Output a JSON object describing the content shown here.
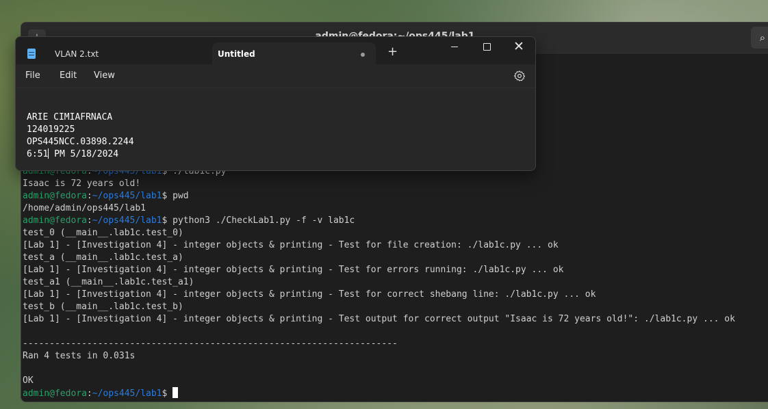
{
  "terminal": {
    "title": "admin@fedora:~/ops445/lab1",
    "new_tab_icon": "+",
    "search_icon": "⌕",
    "prompt_host": "admin@fedora",
    "prompt_sep": ":",
    "prompt_path": "~/ops445/lab1",
    "prompt_dollar": "$",
    "lines": [
      {
        "cmd": " ./lab1c.py"
      },
      {
        "text": "Isaac is 72 years old!"
      },
      {
        "cmd": " pwd"
      },
      {
        "text": "/home/admin/ops445/lab1"
      },
      {
        "cmd": " python3 ./CheckLab1.py -f -v lab1c"
      },
      {
        "text": "test_0 (__main__.lab1c.test_0)"
      },
      {
        "text": "[Lab 1] - [Investigation 4] - integer objects & printing - Test for file creation: ./lab1c.py ... ok"
      },
      {
        "text": "test_a (__main__.lab1c.test_a)"
      },
      {
        "text": "[Lab 1] - [Investigation 4] - integer objects & printing - Test for errors running: ./lab1c.py ... ok"
      },
      {
        "text": "test_a1 (__main__.lab1c.test_a1)"
      },
      {
        "text": "[Lab 1] - [Investigation 4] - integer objects & printing - Test for correct shebang line: ./lab1c.py ... ok"
      },
      {
        "text": "test_b (__main__.lab1c.test_b)"
      },
      {
        "text": "[Lab 1] - [Investigation 4] - integer objects & printing - Test output for correct output \"Isaac is 72 years old!\": ./lab1c.py ... ok"
      },
      {
        "text": ""
      },
      {
        "text": "----------------------------------------------------------------------"
      },
      {
        "text": "Ran 4 tests in 0.031s"
      },
      {
        "text": ""
      },
      {
        "text": "OK"
      }
    ]
  },
  "notepad": {
    "tabs": [
      {
        "label": "VLAN 2.txt"
      },
      {
        "label": "Untitled",
        "unsaved": true
      }
    ],
    "new_tab_label": "+",
    "menu": {
      "file": "File",
      "edit": "Edit",
      "view": "View"
    },
    "lines": [
      "ARIE CIMIAFRNACA",
      "124019225",
      "OPS445NCC.03898.2244"
    ],
    "last_line_before_caret": "6:51",
    "last_line_after_caret": " PM 5/18/2024"
  }
}
